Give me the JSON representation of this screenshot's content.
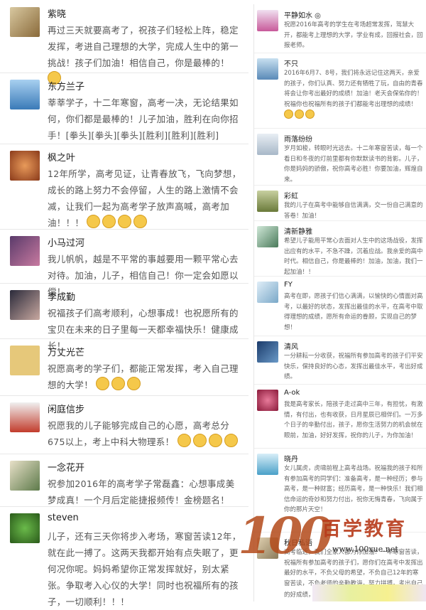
{
  "left_posts": [
    {
      "name": "紫晓",
      "text": "再过三天就要高考了，祝孩子们轻松上阵，稳定发挥，考进自己理想的大学，完成人生中的第一挑战！孩子们加油！相信自己，你是最棒的！",
      "emoji_count": 1,
      "avatar_color": "#b9a16f"
    },
    {
      "name": "东方兰子",
      "text": "莘莘学子，十二年寒窗，高考一决，无论结果如何，你们都是最棒的！儿子加油，胜利在向你招手！[拳头][拳头][拳头][胜利][胜利][胜利]",
      "emoji_count": 0,
      "avatar_color": "#6fa0c8"
    },
    {
      "name": "枫之叶",
      "text": "12年所学，高考见证，让青春放飞，飞向梦想，成长的路上努力不会停留，人生的路上激情不会减，让我们一起为高考学子放声高喊，高考加油！！！",
      "emoji_count": 4,
      "avatar_color": "#c96a3c"
    },
    {
      "name": "小马过河",
      "text": "我儿帆帆，越是不平常的事越要用一颗平常心去对待。加油，儿子，相信自己！你一定会如愿以偿！",
      "emoji_count": 0,
      "avatar_color": "#8a5a7a"
    },
    {
      "name": "李成勤",
      "text": "祝福孩子们高考顺利，心想事成！也祝愿所有的宝贝在未来的日子里每一天都幸福快乐！健康成长！",
      "emoji_count": 0,
      "avatar_color": "#3d3d4a"
    },
    {
      "name": "万丈光芒",
      "text": "祝愿高考的学子们，都能正常发挥，考入自己理想的大学！",
      "emoji_count": 3,
      "avatar_color": "#c9a24a"
    },
    {
      "name": "闲庭信步",
      "text": "祝愿我的儿子能够完成自己的心愿，高考总分675以上，考上中科大物理系！",
      "emoji_count": 4,
      "avatar_color": "#c23c2c"
    },
    {
      "name": "一念花开",
      "text": "祝参加2016年的高考学子常磊鑫：心想事成美梦成真！一个月后定能捷报频传！金榜题名！",
      "emoji_count": 0,
      "avatar_color": "#5d7a4a"
    },
    {
      "name": "steven",
      "text": "儿子，还有三天你将步入考场，寒窗苦读12年，就在此一搏了。这两天我都开始有点失眠了，更何况你呢。妈妈希望你正常发挥就好，别太紧张。争取考入心仪的大学！同时也祝福所有的孩子，一切顺利！！！",
      "emoji_count": 0,
      "avatar_color": "#4a8a3a"
    }
  ],
  "right_posts": [
    {
      "name": "平静如水 ◎",
      "text": "祝愿2016年高考的学生在考场超常发挥，驾慧大开，都能考上理想的大学，学业有成，回报社会，回报老师。",
      "emoji_count": 0,
      "avatar_color": "#c85a9a"
    },
    {
      "name": "不只",
      "text": "2016年6月7、8号，我们将永远记住这两天，亲爱的孩子，你们认真、努力还有牺牲了玩，自由的青春将会让你考出最好的成绩！加油！老天会保佑你的！祝福你也祝福所有的孩子们都能考出理想的成绩！",
      "emoji_count": 3,
      "avatar_color": "#7fa8d0"
    },
    {
      "name": "雨落纷纷",
      "text": "岁月如梭，转眼时光远去。十二年寒窗苦读，每一个看日和冬夜的灯前里都有你默默读书的背影。儿子，你是妈妈的骄傲，祝你高考必胜！你要加油，辉煌自来。",
      "emoji_count": 0,
      "avatar_color": "#b8c8d8"
    },
    {
      "name": "彩虹",
      "text": "我的儿子在高考中能够自信满满，交一份自己满意的答卷！加油！",
      "emoji_count": 0,
      "avatar_color": "#8a9a5a"
    },
    {
      "name": "清新静雅",
      "text": "希望儿子能用平常心去面对人生中的这场战役，发挥出应有的水平，不急不躁，沉着应战。我亲爱的高中时代。相信自己，你是最棒的！加油，加油，我们一起加油！！",
      "emoji_count": 0,
      "avatar_color": "#6a9a7a"
    },
    {
      "name": "FY",
      "text": "高考在即，愿孩子们信心满满，以愉快的心情面对高考，以最好的状态，发挥出最佳的水平，在高考中取得理想的成绩，愿所有命运的眷顾，实现自己的梦想！",
      "emoji_count": 0,
      "avatar_color": "#a8c8e0"
    },
    {
      "name": "清风",
      "text": "一分耕耘一分收获，祝福所有参加高考的孩子们平安快乐，保持良好的心态，发挥出最佳水平，考出好成绩。",
      "emoji_count": 0,
      "avatar_color": "#3a6a9a"
    },
    {
      "name": "A-ok",
      "text": "我是高考家长，陪孩子走过高中三年，有担忧，有激情，有付出，也有收获，日月星辰已相伴们。一万多个日子的辛勤付出，孩子，愿你生活努力的机会就在眼前，加油，好好发挥，祝你的儿子，为你加油！",
      "emoji_count": 0,
      "avatar_color": "#c84a6a"
    },
    {
      "name": "晓丹",
      "text": "女儿属虎，虎啸前程上高考战场。祝福我的孩子和所有参加高考的同学们：准备高考，是一种经历；参与高考，是一种财富；经历高考，是一种快乐！我们相信命运的奇妙和努力付出，祝你无悔青春，飞向属于你的那片天空！",
      "emoji_count": 0,
      "avatar_color": "#4aa0c8"
    },
    {
      "name": "秋日私语",
      "text": "高考临近，我们全家人都为你加油！一年寒窗苦读，祝福所有参加高考的孩子们，愿你们在高考中发挥出最好的水平，不负父母的希望，不负自己12年的寒窗苦读，不负老师的辛勤教诲，努力拼搏，考出自己的好成绩，金榜题名！",
      "emoji_count": 1,
      "avatar_color": "#9a8a6a"
    }
  ],
  "watermark": {
    "logo": "100",
    "brand": "百学教育",
    "url": "www.100xue.net"
  }
}
